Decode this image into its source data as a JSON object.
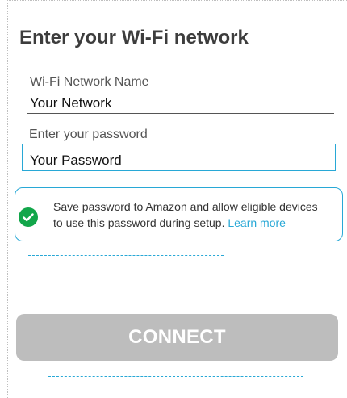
{
  "title": "Enter your Wi-Fi network",
  "network": {
    "label": "Wi-Fi Network Name",
    "value": "Your Network"
  },
  "password": {
    "label": "Enter your password",
    "value": "Your Password"
  },
  "save_password": {
    "icon": "check-circle-icon",
    "text": "Save password to Amazon and allow eligible devices to use this password during setup. ",
    "learn_more": "Learn more",
    "checked": true
  },
  "connect_button": {
    "label": "CONNECT",
    "enabled": false
  },
  "colors": {
    "accent": "#28a8d6",
    "check": "#12a64a",
    "button_disabled": "#bdbdbd",
    "title": "#3d3d3d"
  }
}
